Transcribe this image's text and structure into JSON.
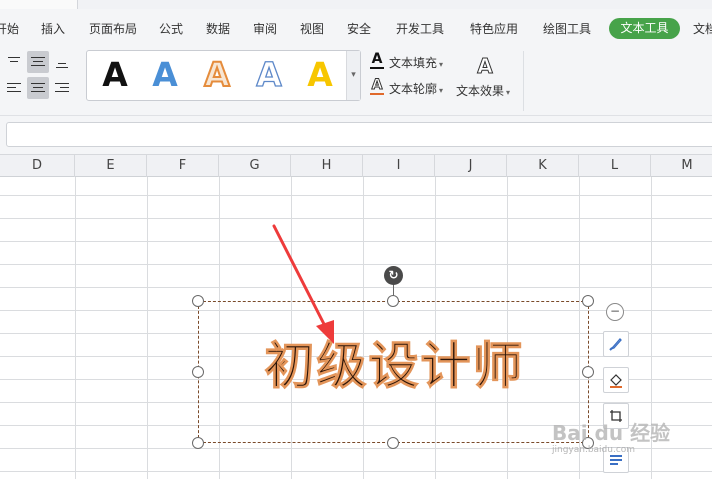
{
  "menu": {
    "items": [
      {
        "label": "开始"
      },
      {
        "label": "插入"
      },
      {
        "label": "页面布局"
      },
      {
        "label": "公式"
      },
      {
        "label": "数据"
      },
      {
        "label": "审阅"
      },
      {
        "label": "视图"
      },
      {
        "label": "安全"
      },
      {
        "label": "开发工具"
      },
      {
        "label": "特色应用"
      },
      {
        "label": "绘图工具"
      },
      {
        "label": "文本工具"
      },
      {
        "label": "文档助手"
      }
    ],
    "active_label": "文本工具",
    "active_color": "#47a34a"
  },
  "ribbon": {
    "alignment_icons": [
      "align-top-icon",
      "align-middle-icon",
      "align-bottom-icon",
      "align-left-icon",
      "align-center-icon",
      "align-right-icon"
    ],
    "wordart_styles": [
      {
        "glyph": "A",
        "style": "black-fill"
      },
      {
        "glyph": "A",
        "style": "blue-fill"
      },
      {
        "glyph": "A",
        "style": "orange-outline"
      },
      {
        "glyph": "A",
        "style": "blue-outline"
      },
      {
        "glyph": "A",
        "style": "yellow-fill"
      }
    ],
    "text_fill_label": "文本填充",
    "text_outline_label": "文本轮廓",
    "text_effect_label": "文本效果",
    "text_effect_icon_glyph": "A"
  },
  "formula_bar": {
    "value": ""
  },
  "sheet": {
    "columns": [
      "D",
      "E",
      "F",
      "G",
      "H",
      "I",
      "J",
      "K",
      "L",
      "M"
    ]
  },
  "textbox": {
    "text": "初级设计师",
    "fill_color": "#2a1408",
    "outline_color": "#e3955a"
  },
  "float_toolbar": {
    "collapse_glyph": "−",
    "buttons": [
      "brush-icon",
      "fill-bucket-icon",
      "crop-icon",
      "text-wrap-icon"
    ]
  },
  "watermark": {
    "brand": "Bai du 经验",
    "url": "jingyan.baidu.com"
  },
  "annotation": {
    "arrow_color": "#ee3b3b"
  }
}
